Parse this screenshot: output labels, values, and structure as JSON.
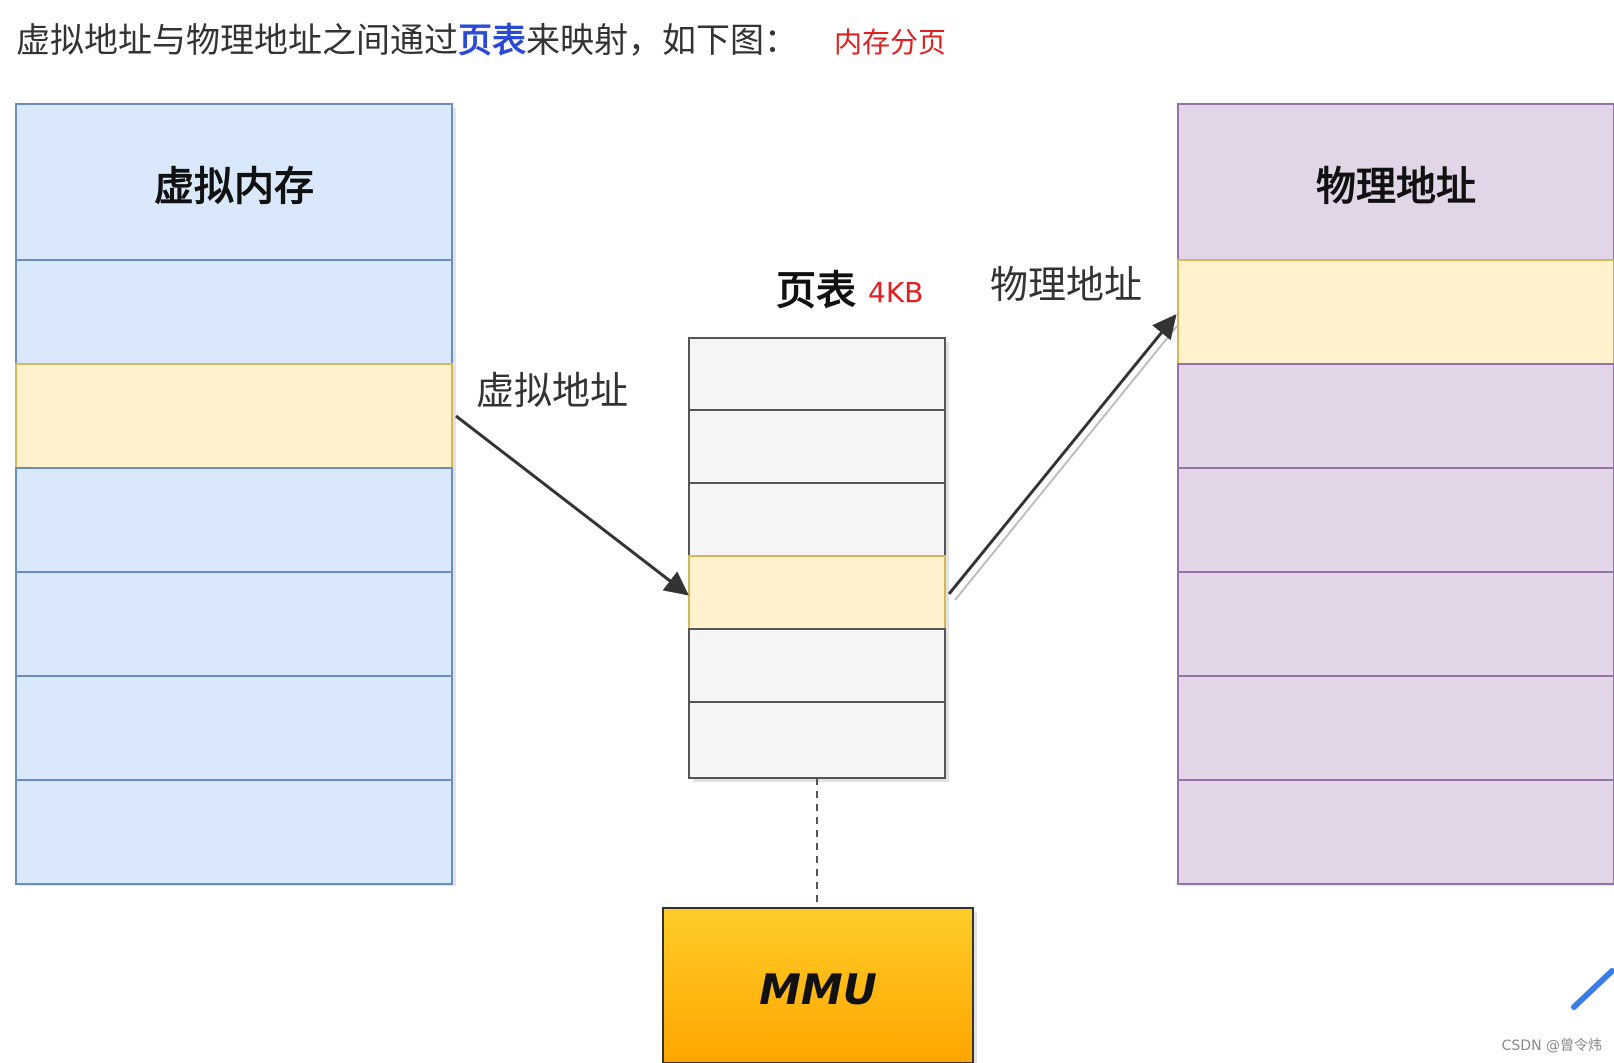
{
  "intro": {
    "before": "虚拟地址与物理地址之间通过",
    "strong": "页表",
    "after": "来映射，如下图：",
    "tag": "内存分页"
  },
  "diagram": {
    "virtual_memory_title": "虚拟内存",
    "physical_memory_title": "物理地址",
    "page_table_title": "页表",
    "page_size": "4KB",
    "virtual_address_label": "虚拟地址",
    "physical_address_label": "物理地址",
    "mmu_label": "MMU"
  },
  "colors": {
    "virtual_fill": "#dae8fc",
    "virtual_stroke": "#6c8ebf",
    "physical_fill": "#e1d5e7",
    "physical_stroke": "#9673a6",
    "highlight_fill": "#fff2cc",
    "highlight_stroke": "#d6b656",
    "table_fill": "#f5f5f5",
    "mmu_top": "#ffcd28",
    "mmu_bottom": "#ffa500",
    "accent_red": "#e02020"
  },
  "footer": {
    "watermark": "CSDN @曾令炜"
  }
}
